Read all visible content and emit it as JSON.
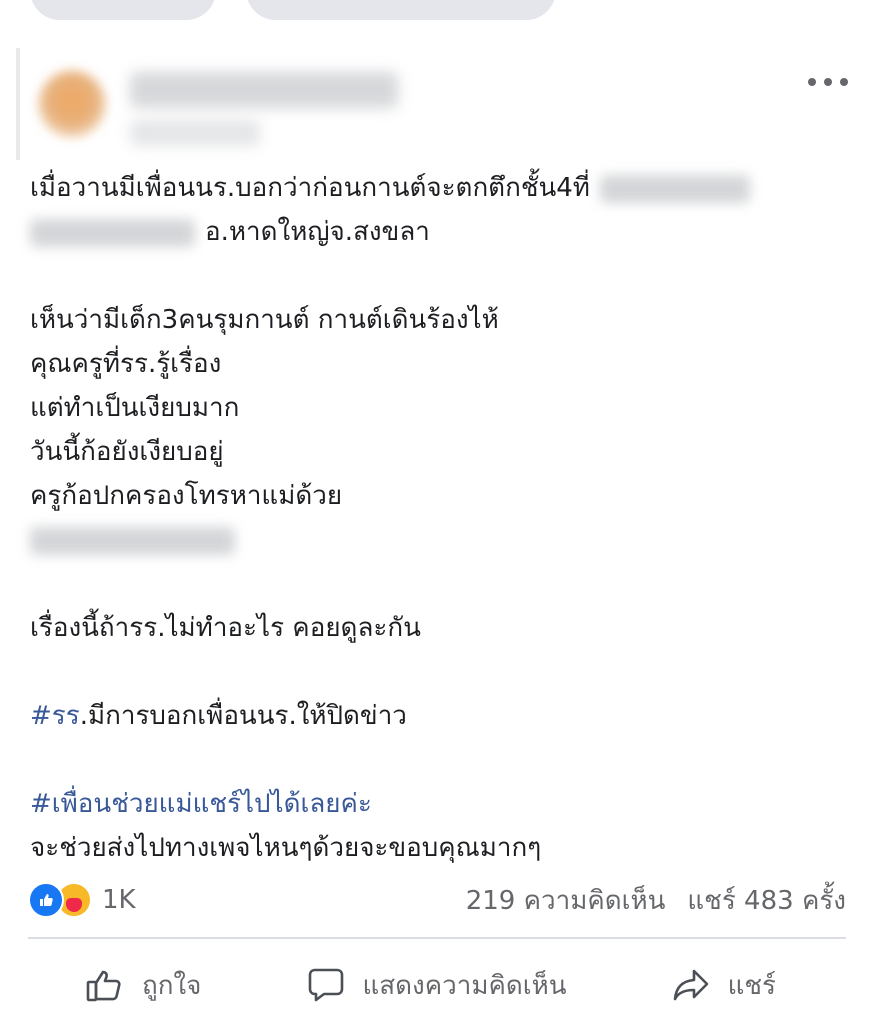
{
  "post": {
    "lines": [
      "เมื่อวานมีเพื่อนนร.บอกว่าก่อนกานต์จะตกตึกชั้น4ที่",
      "อ.หาดใหญ่จ.สงขลา",
      "เห็นว่ามีเด็ก3คนรุมกานต์ กานต์เดินร้องไห้",
      "คุณครูที่รร.รู้เรื่อง",
      "แต่ทำเป็นเงียบมาก",
      "วันนี้ก้อยังเงียบอยู่",
      "ครูก้อปกครองโทรหาแม่ด้วย",
      "เรื่องนี้ถ้ารร.ไม่ทำอะไร คอยดูละกัน",
      "จะช่วยส่งไปทางเพจไหนๆด้วยจะขอบคุณมากๆ"
    ],
    "hashtag1": "#รร",
    "hashtag1_rest": ".มีการบอกเพื่อนนร.ให้ปิดข่าว",
    "hashtag2": "#เพื่อนช่วยแม่แชร์ไปได้เลยค่ะ"
  },
  "stats": {
    "reaction_count": "1K",
    "comments": "219 ความคิดเห็น",
    "shares": "แชร์ 483 ครั้ง"
  },
  "actions": {
    "like": "ถูกใจ",
    "comment": "แสดงความคิดเห็น",
    "share": "แชร์"
  },
  "icons": {
    "more": "more-horizontal-icon",
    "like": "thumbs-up-icon",
    "comment": "comment-bubble-icon",
    "share": "share-arrow-icon"
  },
  "colors": {
    "hashtag": "#385898",
    "like_blue": "#1877f2",
    "care_yellow": "#f7b928",
    "muted": "#65676b"
  }
}
